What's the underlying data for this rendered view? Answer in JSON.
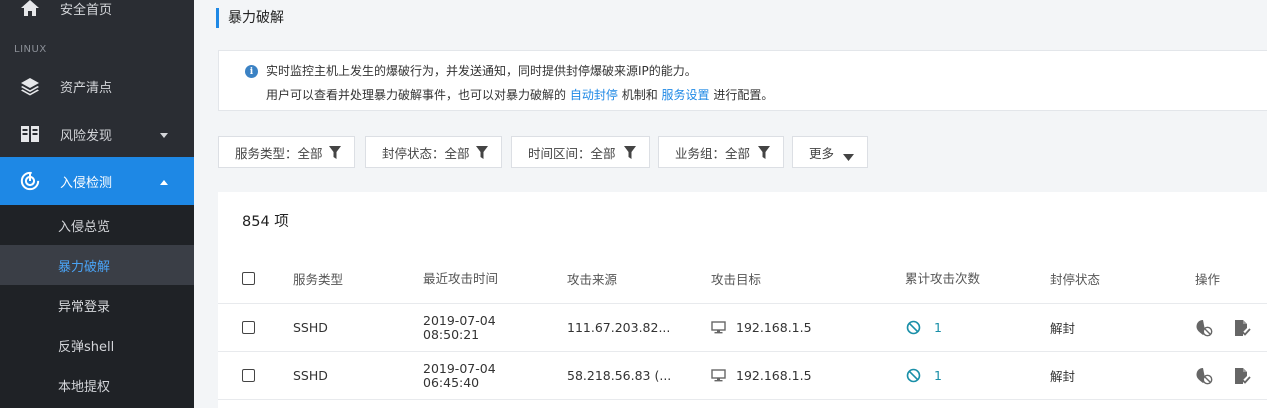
{
  "sidebar": {
    "home": "安全首页",
    "section_linux": "LINUX",
    "assets": "资产清点",
    "risk": "风险发现",
    "intrusion": "入侵检测",
    "sub_items": [
      "入侵总览",
      "暴力破解",
      "异常登录",
      "反弹shell",
      "本地提权"
    ],
    "active_sub": "暴力破解"
  },
  "page": {
    "title": "暴力破解",
    "info_line1": "实时监控主机上发生的爆破行为，并发送通知，同时提供封停爆破来源IP的能力。",
    "info_line2_prefix": "用户可以查看并处理暴力破解事件，也可以对暴力破解的",
    "link_auto_block": "自动封停",
    "info_line2_mid": "机制和",
    "link_service_settings": "服务设置",
    "info_line2_suffix": "进行配置。"
  },
  "filters": {
    "service_type": "服务类型：全部",
    "block_status": "封停状态：全部",
    "time_range": "时间区间：全部",
    "business_group": "业务组：全部",
    "more": "更多"
  },
  "table": {
    "count": "854 项",
    "headers": {
      "service_type": "服务类型",
      "last_attack_time": "最近攻击时间",
      "attack_source": "攻击来源",
      "attack_target": "攻击目标",
      "total_attacks": "累计攻击次数",
      "block_status": "封停状态",
      "actions": "操作"
    },
    "rows": [
      {
        "service": "SSHD",
        "date": "2019-07-04",
        "time": "08:50:21",
        "source": "111.67.203.82...",
        "target": "192.168.1.5",
        "count": "1",
        "status": "解封"
      },
      {
        "service": "SSHD",
        "date": "2019-07-04",
        "time": "06:45:40",
        "source": "58.218.56.83 (...",
        "target": "192.168.1.5",
        "count": "1",
        "status": "解封"
      }
    ]
  },
  "colors": {
    "sidebar_bg": "#2a2d33",
    "active_nav": "#1e88e5",
    "link": "#1e88e5",
    "teal": "#1a8fa8"
  }
}
